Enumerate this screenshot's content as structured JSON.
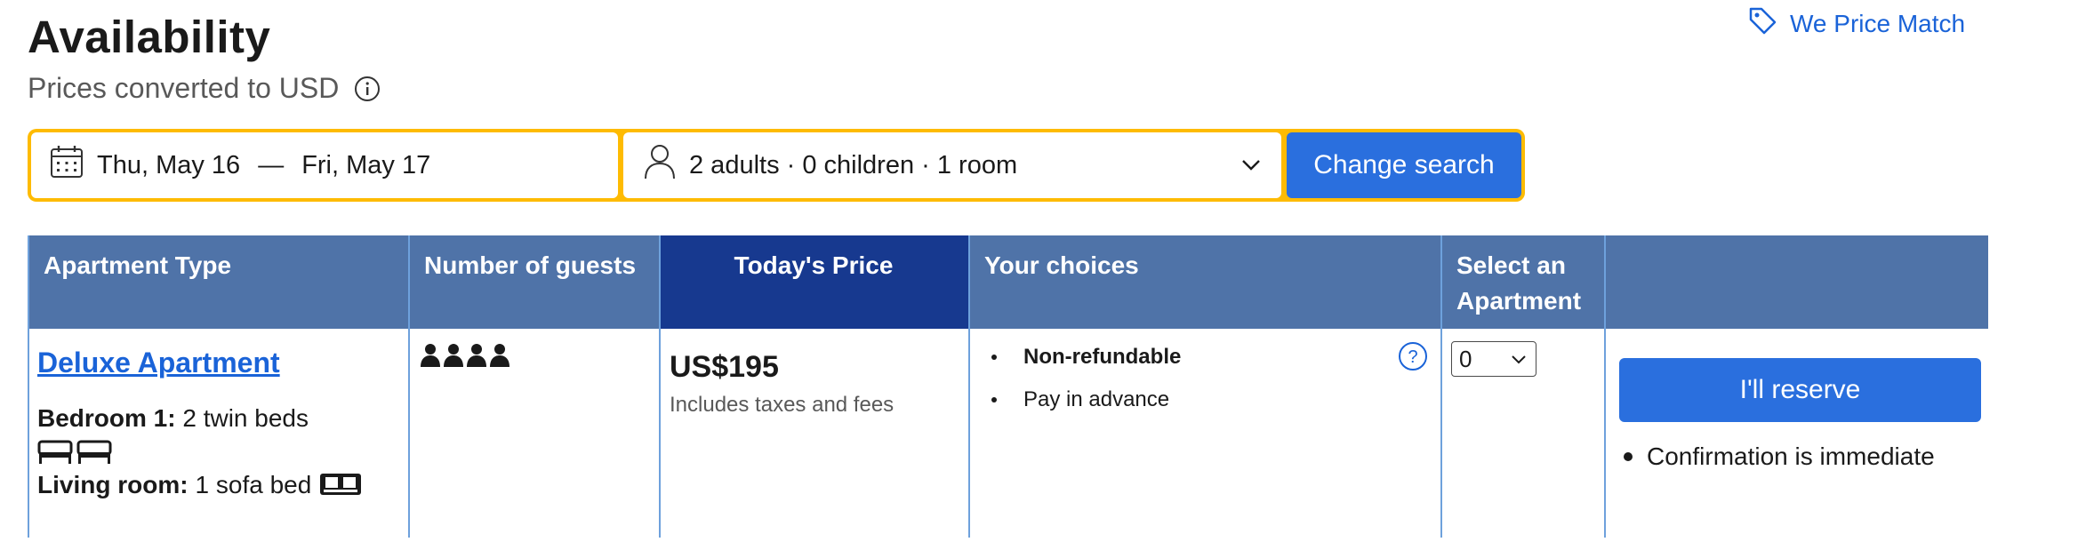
{
  "header": {
    "title": "Availability",
    "subtitle": "Prices converted to USD",
    "price_match": "We Price Match"
  },
  "search": {
    "checkin": "Thu, May 16",
    "dash": "—",
    "checkout": "Fri, May 17",
    "occupancy": "2 adults · 0 children · 1 room",
    "button": "Change search"
  },
  "table": {
    "headers": [
      "Apartment Type",
      "Number of guests",
      "Today's Price",
      "Your choices",
      "Select an Apartment",
      ""
    ],
    "row": {
      "apartment": "Deluxe Apartment",
      "bed1_label": "Bedroom 1:",
      "bed1_value": "2 twin beds",
      "living_label": "Living room:",
      "living_value": "1 sofa bed",
      "max_guests": 4,
      "price": "US$195",
      "price_note": "Includes taxes and fees",
      "choices": [
        "Non-refundable",
        "Pay in advance"
      ],
      "select_value": "0",
      "reserve_button": "I'll reserve",
      "confirmation": "Confirmation is immediate"
    }
  },
  "colors": {
    "brand_blue": "#2a6fde",
    "header_blue": "#4f73a8",
    "active_header": "#17398f",
    "search_yellow": "#febb02",
    "link_blue": "#1a63d8"
  }
}
